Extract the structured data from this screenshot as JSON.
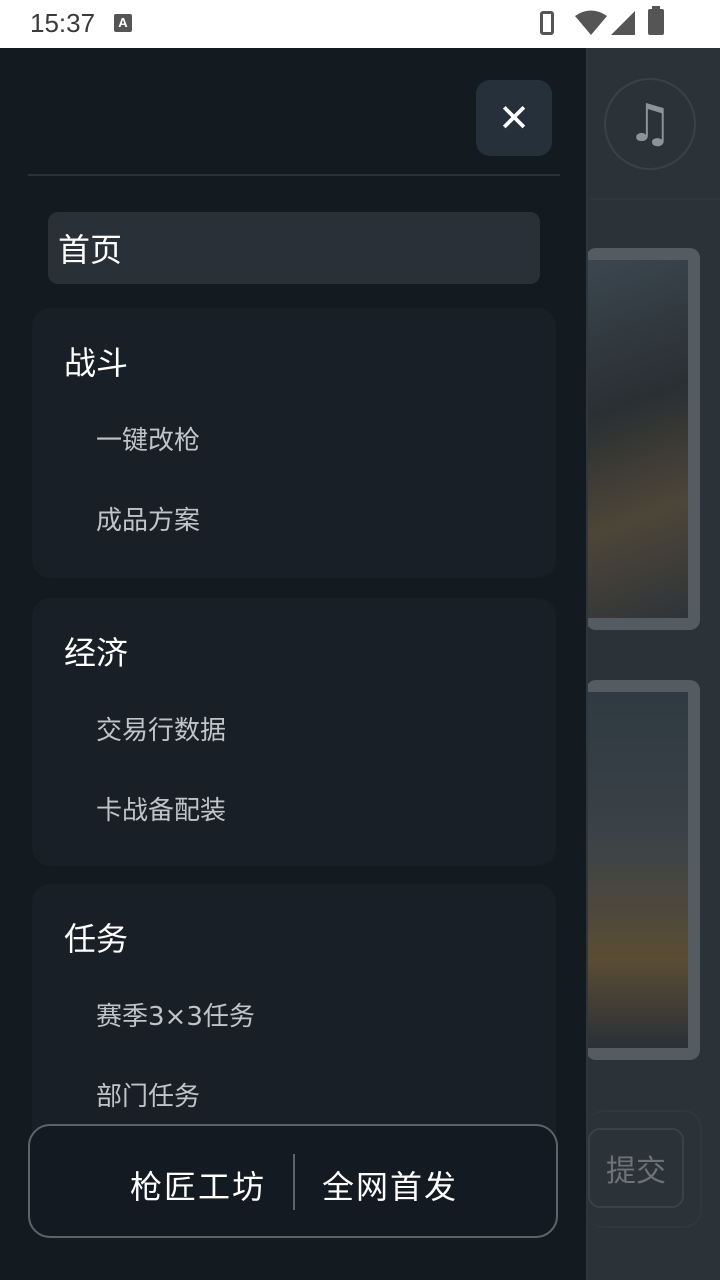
{
  "status_bar": {
    "time": "15:37",
    "a_icon_label": "A"
  },
  "background": {
    "submit_label": "提交",
    "music_icon": "♫"
  },
  "drawer": {
    "close_icon": "✕",
    "home_label": "首页",
    "sections": [
      {
        "title": "战斗",
        "items": [
          "一键改枪",
          "成品方案"
        ]
      },
      {
        "title": "经济",
        "items": [
          "交易行数据",
          "卡战备配装"
        ]
      },
      {
        "title": "任务",
        "items": [
          "赛季3×3任务",
          "部门任务"
        ]
      }
    ],
    "footer": {
      "left": "枪匠工坊",
      "right": "全网首发"
    }
  }
}
